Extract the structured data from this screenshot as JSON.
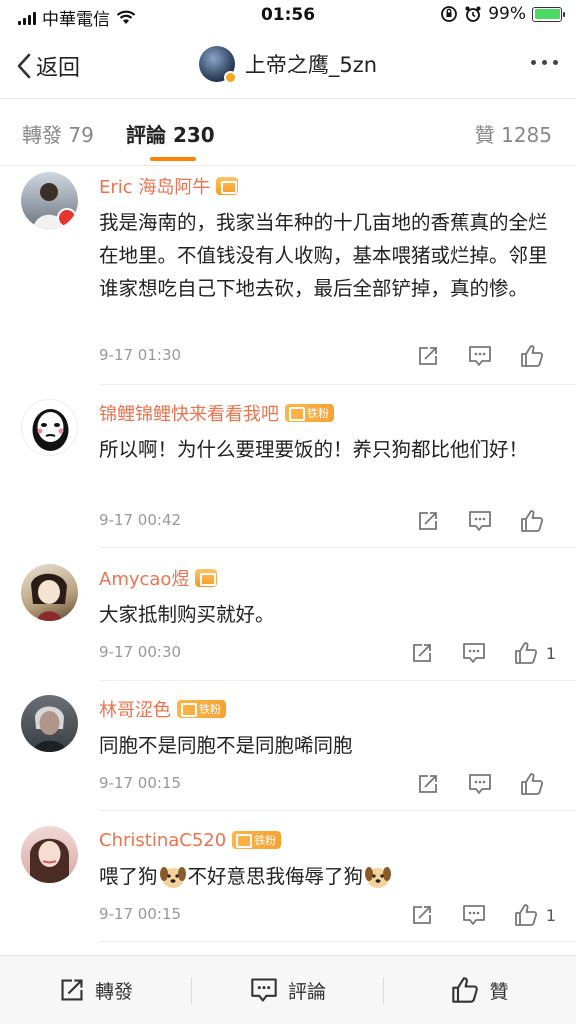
{
  "status_bar": {
    "carrier": "中華電信",
    "time": "01:56",
    "battery": "99%"
  },
  "nav": {
    "back_label": "返回",
    "title": "上帝之鹰_5zn"
  },
  "tabs": {
    "repost": "轉發 79",
    "comment_label": "評論",
    "comment_count": "230",
    "like": "贊 1285"
  },
  "comments": [
    {
      "name": "Eric 海岛阿牛",
      "text": "我是海南的，我家当年种的十几亩地的香蕉真的全烂在地里。不值钱没有人收购，基本喂猪或烂掉。邻里谁家想吃自己下地去砍，最后全部铲掉，真的惨。",
      "time": "9-17 01:30",
      "likes": ""
    },
    {
      "name": "锦鲤锦鲤快来看看我吧",
      "badge": "铁粉",
      "text": "所以啊！为什么要理要饭的！养只狗都比他们好！",
      "time": "9-17 00:42",
      "likes": ""
    },
    {
      "name": "Amycao煜",
      "text": "大家抵制购买就好。",
      "time": "9-17 00:30",
      "likes": "1"
    },
    {
      "name": "林哥涩色",
      "badge": "铁粉",
      "text": "同胞不是同胞不是同胞唏同胞",
      "time": "9-17 00:15",
      "likes": ""
    },
    {
      "name": "ChristinaC520",
      "badge": "铁粉",
      "text_a": "喂了狗",
      "text_b": "不好意思我侮辱了狗",
      "time": "9-17 00:15",
      "likes": "1"
    }
  ],
  "bottom_bar": {
    "repost": "轉發",
    "comment": "評論",
    "like": "贊"
  },
  "colors": {
    "accent": "#ff8200",
    "username": "#eb7350",
    "badge": "#f7a233"
  }
}
